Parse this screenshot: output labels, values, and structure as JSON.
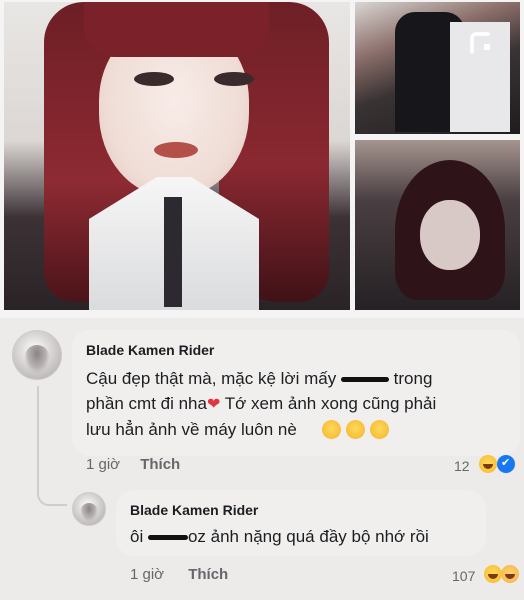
{
  "post": {
    "photos": [
      {
        "name": "main-photo"
      },
      {
        "name": "top-right-photo"
      },
      {
        "name": "bottom-right-photo"
      }
    ]
  },
  "comments": [
    {
      "author": "Blade Kamen Rider",
      "text_line1_a": "Cậu đẹp thật mà, mặc kệ lời mấy ",
      "text_line1_b": " trong",
      "text_line2_a": "phần cmt đi nha",
      "text_line2_b": " Tớ xem ảnh xong cũng phải",
      "text_line3": "lưu hẳn ảnh về máy luôn nè",
      "time": "1 giờ",
      "action_like": "Thích",
      "reaction_count": "12",
      "reactions": [
        "haha-icon",
        "like-icon"
      ],
      "emojis": [
        "kiss-emoji",
        "kiss-emoji",
        "kiss-emoji"
      ]
    },
    {
      "author": "Blade Kamen Rider",
      "text_a": "ôi ",
      "text_b": "oz ảnh nặng quá đầy bộ nhớ rồi",
      "time": "1 giờ",
      "action_like": "Thích",
      "reaction_count": "107",
      "reactions": [
        "haha-icon",
        "sad-icon"
      ]
    }
  ],
  "colors": {
    "background": "#ecebe9",
    "bubble": "#f0efed",
    "meta_text": "#65676b",
    "heart": "#e0343e",
    "like_blue": "#1877f2"
  }
}
